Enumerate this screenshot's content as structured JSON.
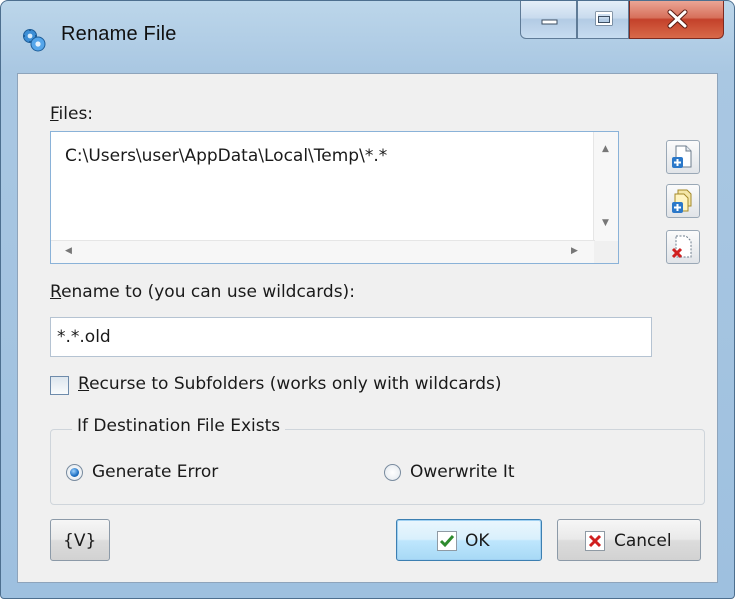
{
  "window": {
    "title": "Rename File",
    "app_icon": "gear-sync-icon",
    "caption_buttons": [
      "minimize-icon",
      "maximize-icon",
      "close-icon"
    ]
  },
  "files": {
    "label_accel": "F",
    "label_rest": "iles:",
    "items": [
      "C:\\Users\\user\\AppData\\Local\\Temp\\*.*"
    ],
    "side_buttons": [
      "add-file-icon",
      "add-folder-icon",
      "remove-file-icon"
    ]
  },
  "rename": {
    "label_accel": "R",
    "label_rest": "ename to (you can use wildcards):",
    "value": "*.*.old"
  },
  "recurse": {
    "label_accel": "R",
    "label_rest": "ecurse to Subfolders (works only with wildcards)",
    "checked": false
  },
  "destination": {
    "group_title": "If Destination File Exists",
    "options": [
      {
        "label": "Generate Error",
        "selected": true
      },
      {
        "label": "Owerwrite It",
        "selected": false
      }
    ]
  },
  "buttons": {
    "variables": "{V}",
    "ok": "OK",
    "cancel": "Cancel"
  },
  "colors": {
    "frame": "#a9c7e2",
    "close_button": "#c4412a",
    "ok_check": "#2e8b2e",
    "cancel_x": "#d02020"
  }
}
